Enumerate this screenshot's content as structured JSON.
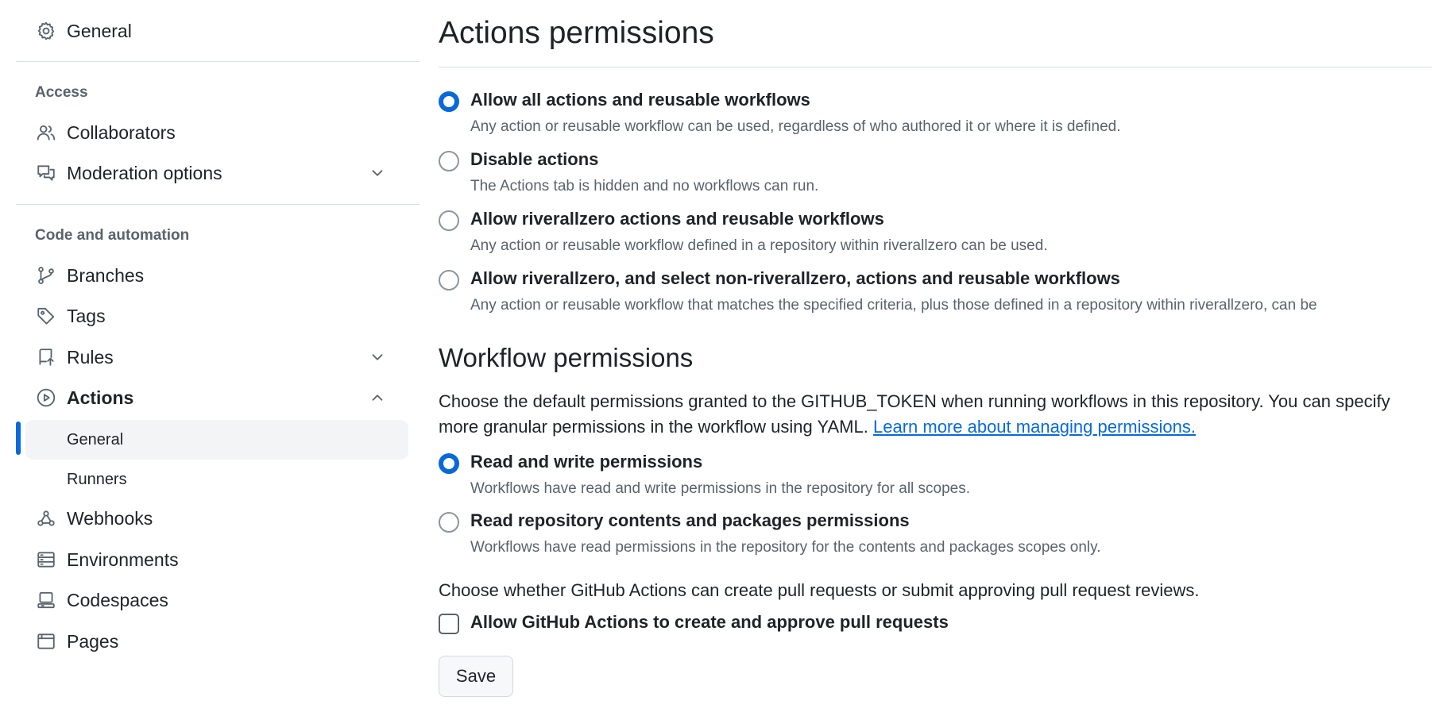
{
  "sidebar": {
    "general": {
      "label": "General",
      "icon": "gear-icon"
    },
    "access_title": "Access",
    "collaborators": {
      "label": "Collaborators",
      "icon": "people-icon"
    },
    "moderation": {
      "label": "Moderation options",
      "icon": "comment-discussion-icon"
    },
    "code_title": "Code and automation",
    "branches": {
      "label": "Branches",
      "icon": "git-branch-icon"
    },
    "tags": {
      "label": "Tags",
      "icon": "tag-icon"
    },
    "rules": {
      "label": "Rules",
      "icon": "repo-push-icon"
    },
    "actions": {
      "label": "Actions",
      "icon": "play-icon"
    },
    "actions_sub": [
      {
        "label": "General",
        "active": true
      },
      {
        "label": "Runners",
        "active": false
      }
    ],
    "webhooks": {
      "label": "Webhooks",
      "icon": "webhook-icon"
    },
    "environments": {
      "label": "Environments",
      "icon": "server-icon"
    },
    "codespaces": {
      "label": "Codespaces",
      "icon": "codespaces-icon"
    },
    "pages": {
      "label": "Pages",
      "icon": "browser-icon"
    }
  },
  "main": {
    "title": "Actions permissions",
    "actions_options": [
      {
        "label": "Allow all actions and reusable workflows",
        "desc": "Any action or reusable workflow can be used, regardless of who authored it or where it is defined.",
        "checked": true
      },
      {
        "label": "Disable actions",
        "desc": "The Actions tab is hidden and no workflows can run.",
        "checked": false
      },
      {
        "label": "Allow riverallzero actions and reusable workflows",
        "desc": "Any action or reusable workflow defined in a repository within riverallzero can be used.",
        "checked": false
      },
      {
        "label": "Allow riverallzero, and select non-riverallzero, actions and reusable workflows",
        "desc": "Any action or reusable workflow that matches the specified criteria, plus those defined in a repository within riverallzero, can be",
        "checked": false
      }
    ],
    "workflow_title": "Workflow permissions",
    "workflow_intro": "Choose the default permissions granted to the GITHUB_TOKEN when running workflows in this repository. You can specify more granular permissions in the workflow using YAML.",
    "workflow_link": "Learn more about managing permissions.",
    "workflow_options": [
      {
        "label": "Read and write permissions",
        "desc": "Workflows have read and write permissions in the repository for all scopes.",
        "checked": true
      },
      {
        "label": "Read repository contents and packages permissions",
        "desc": "Workflows have read permissions in the repository for the contents and packages scopes only.",
        "checked": false
      }
    ],
    "pr_intro": "Choose whether GitHub Actions can create pull requests or submit approving pull request reviews.",
    "pr_checkbox": {
      "label": "Allow GitHub Actions to create and approve pull requests",
      "checked": false
    },
    "save_label": "Save"
  },
  "colors": {
    "accent": "#0969da",
    "muted": "#59636e",
    "active_bg": "#f2f4f6"
  }
}
